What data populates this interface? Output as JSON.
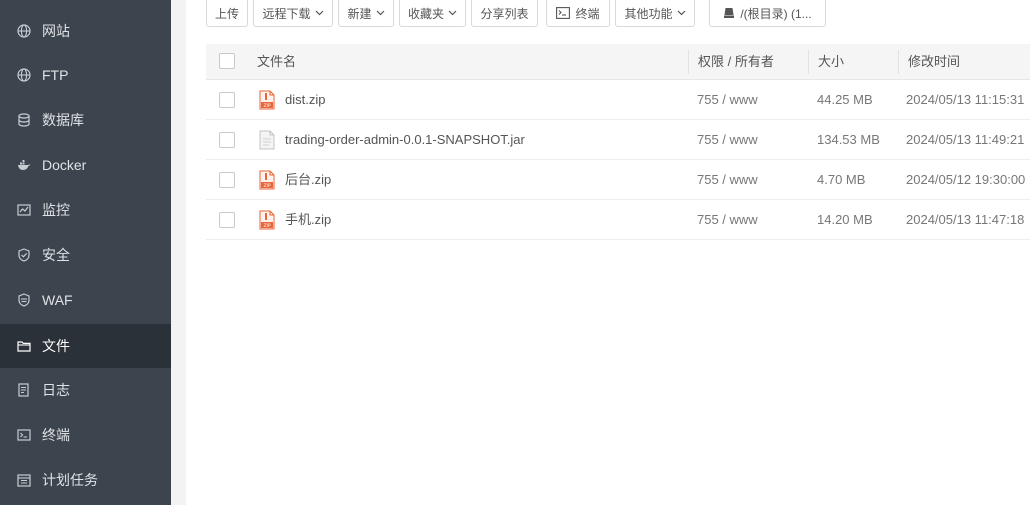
{
  "sidebar": {
    "items": [
      {
        "label": "网站",
        "icon": "globe-icon",
        "active": false
      },
      {
        "label": "FTP",
        "icon": "globe-icon",
        "active": false
      },
      {
        "label": "数据库",
        "icon": "database-icon",
        "active": false
      },
      {
        "label": "Docker",
        "icon": "docker-icon",
        "active": false
      },
      {
        "label": "监控",
        "icon": "monitor-chart-icon",
        "active": false
      },
      {
        "label": "安全",
        "icon": "shield-icon",
        "active": false
      },
      {
        "label": "WAF",
        "icon": "waf-shield-icon",
        "active": false
      },
      {
        "label": "文件",
        "icon": "folder-icon",
        "active": true
      },
      {
        "label": "日志",
        "icon": "log-icon",
        "active": false
      },
      {
        "label": "终端",
        "icon": "terminal-icon",
        "active": false
      },
      {
        "label": "计划任务",
        "icon": "calendar-icon",
        "active": false
      }
    ]
  },
  "toolbar": {
    "upload": "上传",
    "remote_download": "远程下载",
    "new": "新建",
    "favorites": "收藏夹",
    "share_list": "分享列表",
    "terminal": "终端",
    "other_functions": "其他功能",
    "path": "/(根目录) (1..."
  },
  "table": {
    "headers": {
      "name": "文件名",
      "permission": "权限 / 所有者",
      "size": "大小",
      "modified": "修改时间"
    },
    "rows": [
      {
        "name": "dist.zip",
        "type": "zip",
        "permission": "755 / www",
        "size": "44.25 MB",
        "modified": "2024/05/13 11:15:31"
      },
      {
        "name": "trading-order-admin-0.0.1-SNAPSHOT.jar",
        "type": "file",
        "permission": "755 / www",
        "size": "134.53 MB",
        "modified": "2024/05/13 11:49:21"
      },
      {
        "name": "后台.zip",
        "type": "zip",
        "permission": "755 / www",
        "size": "4.70 MB",
        "modified": "2024/05/12 19:30:00"
      },
      {
        "name": "手机.zip",
        "type": "zip",
        "permission": "755 / www",
        "size": "14.20 MB",
        "modified": "2024/05/13 11:47:18"
      }
    ]
  },
  "colors": {
    "sidebar_bg": "#3c444d",
    "sidebar_active_bg": "#2b3138",
    "zip_icon": "#e8663a"
  }
}
